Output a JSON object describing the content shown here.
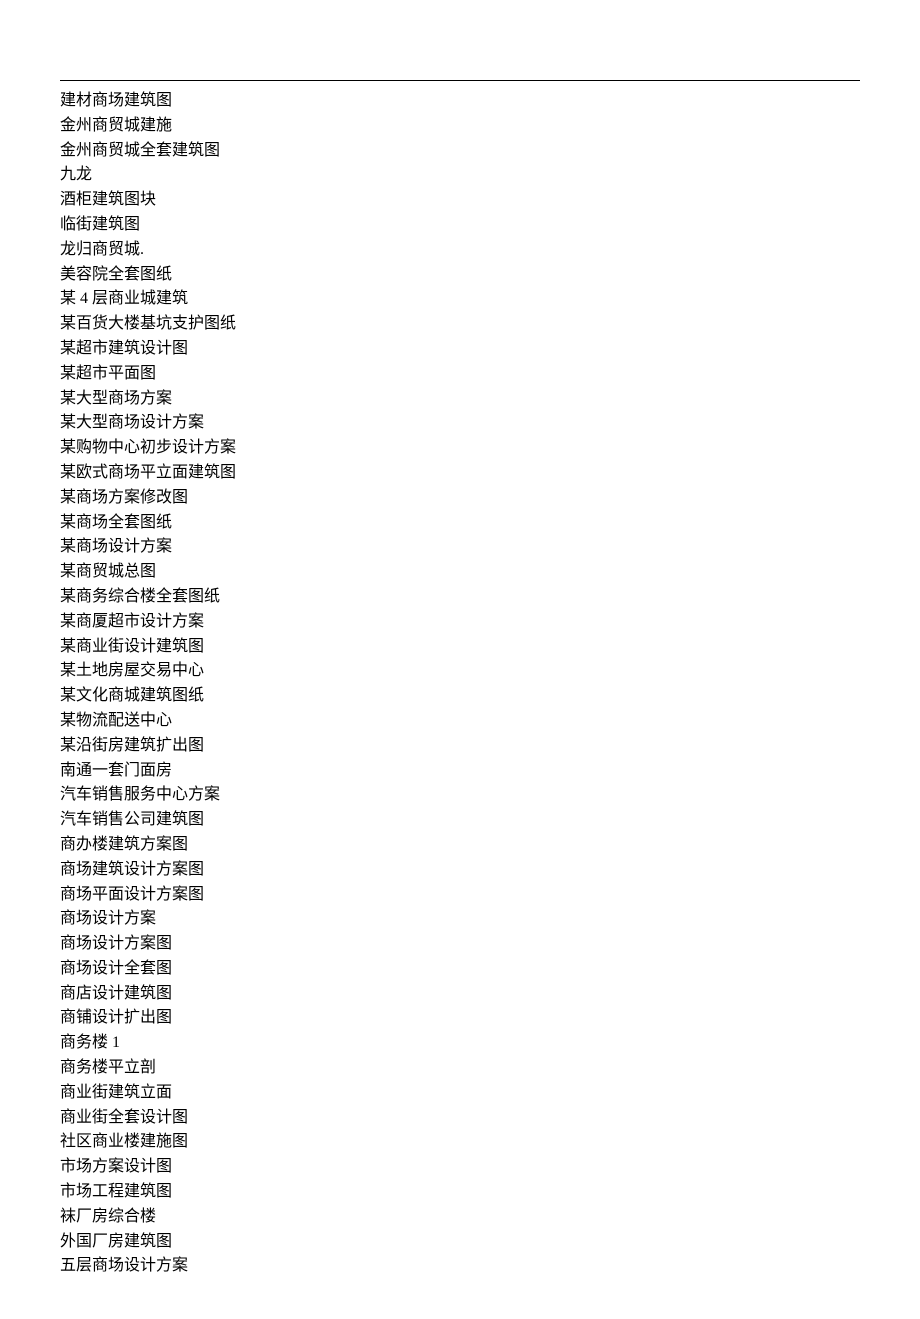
{
  "items": [
    "建材商场建筑图",
    "金州商贸城建施",
    "金州商贸城全套建筑图",
    "九龙",
    "酒柜建筑图块",
    "临街建筑图",
    "龙归商贸城.",
    "美容院全套图纸",
    "某 4 层商业城建筑",
    "某百货大楼基坑支护图纸",
    "某超市建筑设计图",
    "某超市平面图",
    "某大型商场方案",
    "某大型商场设计方案",
    "某购物中心初步设计方案",
    "某欧式商场平立面建筑图",
    "某商场方案修改图",
    "某商场全套图纸",
    "某商场设计方案",
    "某商贸城总图",
    "某商务综合楼全套图纸",
    "某商厦超市设计方案",
    "某商业街设计建筑图",
    "某土地房屋交易中心",
    "某文化商城建筑图纸",
    "某物流配送中心",
    "某沿街房建筑扩出图",
    "南通一套门面房",
    "汽车销售服务中心方案",
    "汽车销售公司建筑图",
    "商办楼建筑方案图",
    "商场建筑设计方案图",
    "商场平面设计方案图",
    "商场设计方案",
    "商场设计方案图",
    "商场设计全套图",
    "商店设计建筑图",
    "商铺设计扩出图",
    "商务楼 1",
    "商务楼平立剖",
    "商业街建筑立面",
    "商业街全套设计图",
    "社区商业楼建施图",
    "市场方案设计图",
    "市场工程建筑图",
    "袜厂房综合楼",
    "外国厂房建筑图",
    "五层商场设计方案"
  ]
}
